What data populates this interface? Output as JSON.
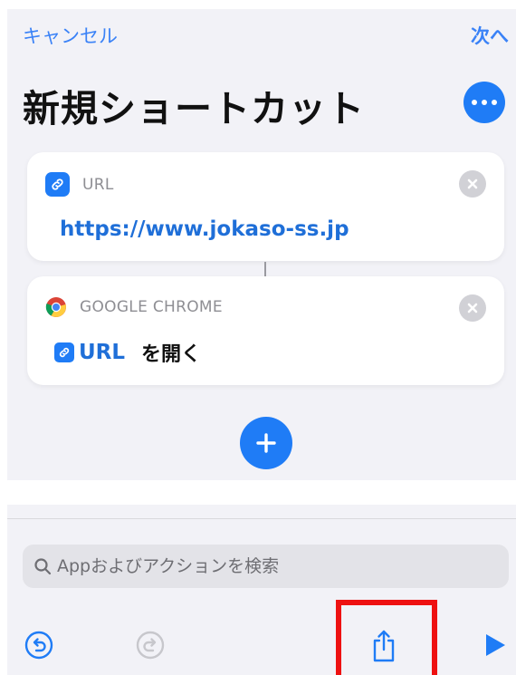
{
  "nav": {
    "cancel_label": "キャンセル",
    "next_label": "次へ"
  },
  "page": {
    "title": "新規ショートカット"
  },
  "cards": {
    "url_card": {
      "type_label": "URL",
      "icon": "link-icon",
      "value": "https://www.jokaso-ss.jp"
    },
    "chrome_card": {
      "type_label": "GOOGLE CHROME",
      "icon": "chrome-icon",
      "token_label": "URL",
      "action_label": "を開く"
    }
  },
  "search": {
    "placeholder": "Appおよびアクションを検索",
    "value": ""
  },
  "toolbar": {
    "icons": [
      "undo-icon",
      "redo-icon",
      "share-icon",
      "play-icon"
    ]
  },
  "colors": {
    "accent": "#1f7cf6",
    "link_text": "#1f6fd8",
    "background": "#f2f2f7",
    "highlight": "#ee1111"
  }
}
